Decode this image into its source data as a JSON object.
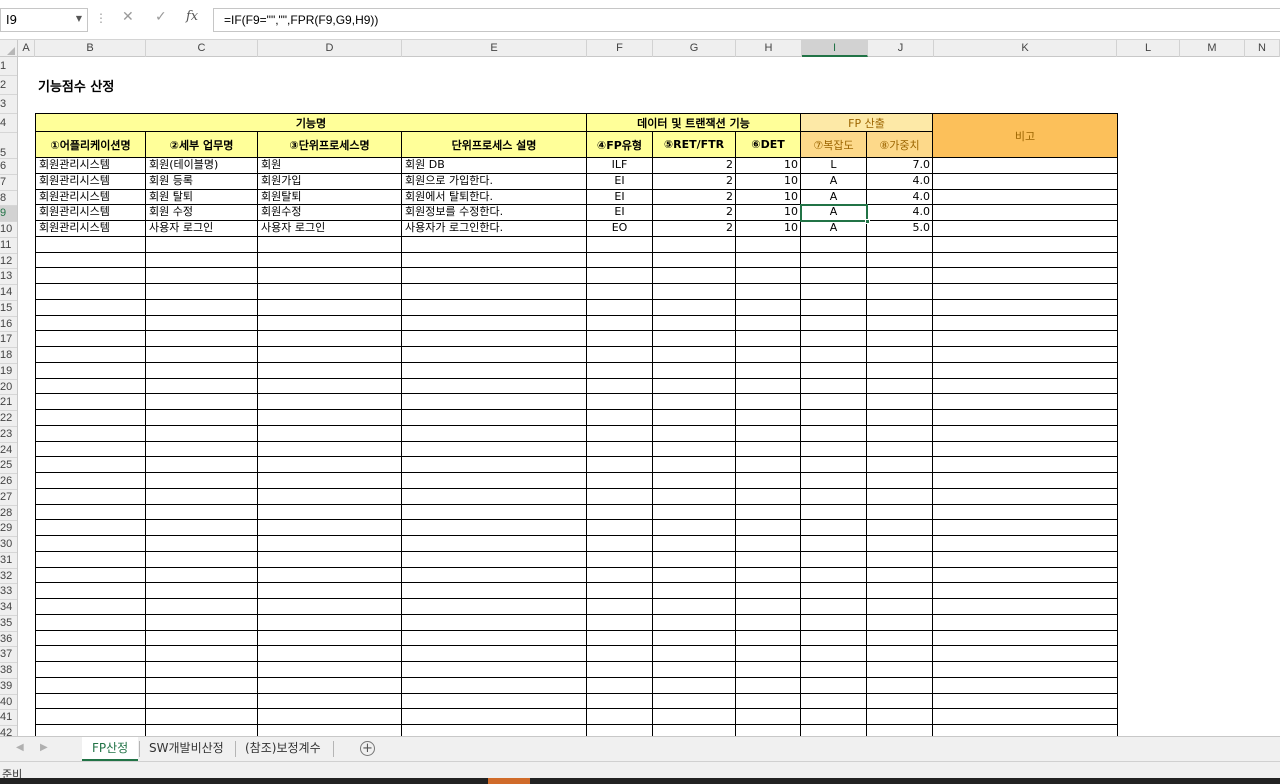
{
  "formula_bar": {
    "name_box": "I9",
    "formula": "=IF(F9=\"\",\"\",FPR(F9,G9,H9))"
  },
  "columns": [
    "A",
    "B",
    "C",
    "D",
    "E",
    "F",
    "G",
    "H",
    "I",
    "J",
    "K",
    "L",
    "M",
    "N"
  ],
  "rows": [
    "1",
    "2",
    "3",
    "4",
    "5",
    "6",
    "7",
    "8",
    "9",
    "10",
    "11",
    "12",
    "13",
    "14",
    "15",
    "16",
    "17",
    "18",
    "19",
    "20",
    "21",
    "22",
    "23",
    "24",
    "25",
    "26",
    "27",
    "28",
    "29",
    "30",
    "31",
    "32",
    "33",
    "34",
    "35",
    "36",
    "37",
    "38",
    "39",
    "40",
    "41",
    "42"
  ],
  "sheet": {
    "title": "기능점수 산정",
    "group_headers": {
      "function_name": "기능명",
      "data_transaction": "데이터 및 트랜잭션 기능",
      "fp_calc": "FP 산출",
      "note": "비고"
    },
    "sub_headers": {
      "app_name": "①어플리케이션명",
      "detail_task": "②세부 업무명",
      "unit_process": "③단위프로세스명",
      "unit_process_desc": "단위프로세스 설명",
      "fp_type": "④FP유형",
      "ret_ftr": "⑤RET/FTR",
      "det": "⑥DET",
      "complexity": "⑦복잡도",
      "weight": "⑧가중치"
    },
    "data_rows": [
      {
        "app": "회원관리시스템",
        "task": "회원(테이블명)",
        "process": "회원",
        "desc": "회원 DB",
        "type": "ILF",
        "ret": "2",
        "det": "10",
        "cx": "L",
        "w": "7.0"
      },
      {
        "app": "회원관리시스템",
        "task": "회원 등록",
        "process": "회원가입",
        "desc": "회원으로 가입한다.",
        "type": "EI",
        "ret": "2",
        "det": "10",
        "cx": "A",
        "w": "4.0"
      },
      {
        "app": "회원관리시스템",
        "task": "회원 탈퇴",
        "process": "회원탈퇴",
        "desc": "회원에서 탈퇴한다.",
        "type": "EI",
        "ret": "2",
        "det": "10",
        "cx": "A",
        "w": "4.0"
      },
      {
        "app": "회원관리시스템",
        "task": "회원 수정",
        "process": "회원수정",
        "desc": "회원정보를 수정한다.",
        "type": "EI",
        "ret": "2",
        "det": "10",
        "cx": "A",
        "w": "4.0"
      },
      {
        "app": "회원관리시스템",
        "task": "사용자 로그인",
        "process": "사용자 로그인",
        "desc": "사용자가 로그인한다.",
        "type": "EO",
        "ret": "2",
        "det": "10",
        "cx": "A",
        "w": "5.0"
      }
    ]
  },
  "tabs": [
    {
      "label": "FP산정",
      "active": true
    },
    {
      "label": "SW개발비산정",
      "active": false
    },
    {
      "label": "(참조)보정계수",
      "active": false
    }
  ],
  "status": "준비",
  "colors": {
    "accent": "#217346",
    "header_yellow": "#ffff99",
    "note_orange": "#fcc05a"
  }
}
